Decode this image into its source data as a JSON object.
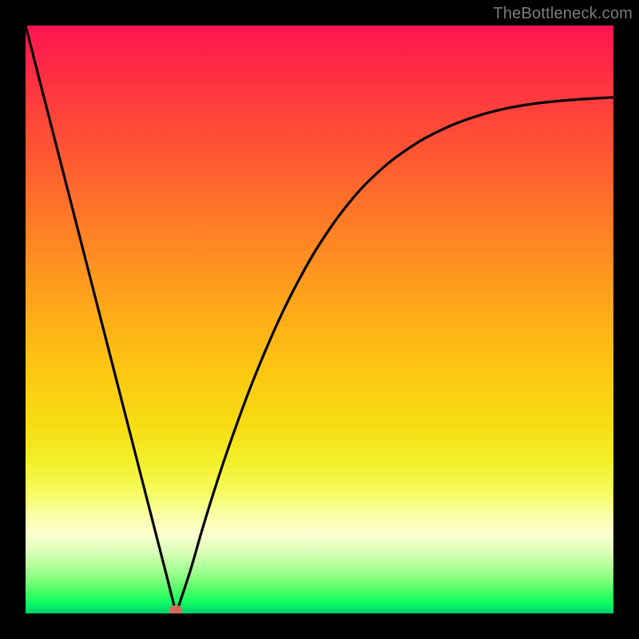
{
  "watermark": "TheBottleneck.com",
  "chart_data": {
    "type": "line",
    "title": "",
    "xlabel": "",
    "ylabel": "",
    "xlim": [
      0,
      100
    ],
    "ylim": [
      0,
      100
    ],
    "grid": false,
    "legend": false,
    "series": [
      {
        "name": "bottleneck-curve",
        "x": [
          0,
          5,
          10,
          15,
          20,
          22,
          24,
          25.6,
          28,
          30,
          32,
          34,
          36,
          38,
          40,
          43,
          46,
          50,
          55,
          60,
          65,
          70,
          75,
          80,
          85,
          90,
          95,
          100
        ],
        "values": [
          100,
          80.5,
          61,
          41.5,
          22,
          14.2,
          6.4,
          0,
          7.2,
          14.1,
          20.6,
          26.7,
          32.4,
          37.8,
          42.8,
          49.7,
          55.8,
          62.8,
          69.8,
          75.1,
          79,
          81.9,
          84,
          85.5,
          86.5,
          87.1,
          87.5,
          87.8
        ]
      }
    ],
    "marker": {
      "x": 25.6,
      "y": 0,
      "color": "#d66a5a"
    },
    "background_gradient": {
      "type": "vertical",
      "stops": [
        {
          "pos": 0.0,
          "color": "#ff1450"
        },
        {
          "pos": 0.3,
          "color": "#ff6a2c"
        },
        {
          "pos": 0.6,
          "color": "#fcca11"
        },
        {
          "pos": 0.8,
          "color": "#f5fb59"
        },
        {
          "pos": 0.9,
          "color": "#b0ff9a"
        },
        {
          "pos": 1.0,
          "color": "#00cc6b"
        }
      ]
    }
  }
}
